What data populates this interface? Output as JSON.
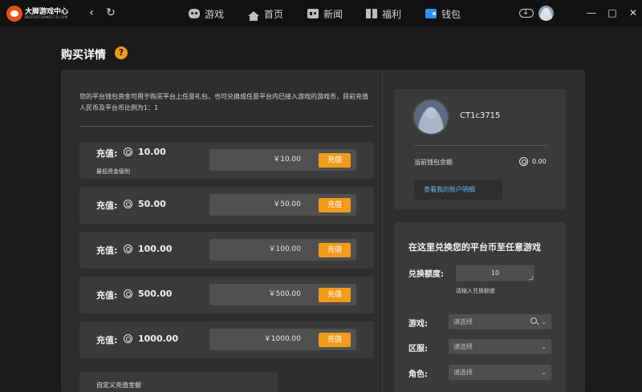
{
  "app": {
    "logo_title": "大脚游戏中心",
    "logo_sub": "BIGFOOTGAMES.TR.COM"
  },
  "nav": {
    "back_icon": "‹",
    "refresh_icon": "↻",
    "items": [
      {
        "label": "游戏",
        "icon": "gamepad-icon"
      },
      {
        "label": "首页",
        "icon": "home-icon"
      },
      {
        "label": "新闻",
        "icon": "news-icon"
      },
      {
        "label": "福利",
        "icon": "gift-icon"
      },
      {
        "label": "钱包",
        "icon": "wallet-icon",
        "active": true
      }
    ],
    "window": {
      "minimize": "—",
      "maximize": "□",
      "close": "✕"
    }
  },
  "page": {
    "title": "购买详情",
    "help": "?",
    "intro": "您的平台钱包资金可用于购买平台上任意礼包，也可兑换成任意平台内已接入游戏的游戏币，目前充值人民币及平台币比例为1：1"
  },
  "recharge": {
    "label": "充值:",
    "button": "充值",
    "min_note": "最低资金级别",
    "rows": [
      {
        "amount": "10.00",
        "price": "￥10.00"
      },
      {
        "amount": "50.00",
        "price": "￥50.00"
      },
      {
        "amount": "100.00",
        "price": "￥100.00"
      },
      {
        "amount": "500.00",
        "price": "￥500.00"
      },
      {
        "amount": "1000.00",
        "price": "￥1000.00"
      }
    ],
    "custom_label": "自定义充值金额"
  },
  "user": {
    "name": "CT1c3715",
    "balance_label": "当前钱包余额",
    "balance_value": "0.00",
    "account_link": "查看我的账户明细"
  },
  "exchange": {
    "title": "在这里兑换您的平台币至任意游戏",
    "amount_label": "兑换额度:",
    "amount_value": "10",
    "amount_hint": "请输入兑换额度",
    "selects": [
      {
        "label": "游戏:",
        "placeholder": "请选择",
        "searchable": true
      },
      {
        "label": "区服:",
        "placeholder": "请选择",
        "searchable": false
      },
      {
        "label": "角色:",
        "placeholder": "请选择",
        "searchable": false
      }
    ]
  },
  "colors": {
    "accent": "#f19b1b",
    "link": "#67b7e8",
    "background": "#1b1b1b",
    "panel": "#2e2e2e",
    "card": "#3a3a3a"
  }
}
